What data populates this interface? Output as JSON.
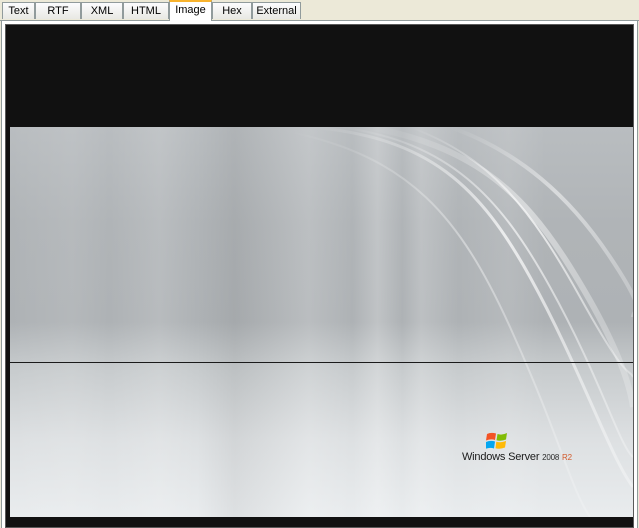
{
  "tabs": [
    {
      "label": "Text",
      "active": false
    },
    {
      "label": "RTF",
      "active": false
    },
    {
      "label": "XML",
      "active": false
    },
    {
      "label": "HTML",
      "active": false
    },
    {
      "label": "Image",
      "active": true
    },
    {
      "label": "Hex",
      "active": false
    },
    {
      "label": "External",
      "active": false
    }
  ],
  "image": {
    "logo_text": "Windows Server",
    "logo_version": "2008",
    "logo_edition": "R2"
  },
  "colors": {
    "active_tab_accent": "#f8b32d",
    "viewer_background": "#111111",
    "logo_edition": "#d2592a"
  }
}
